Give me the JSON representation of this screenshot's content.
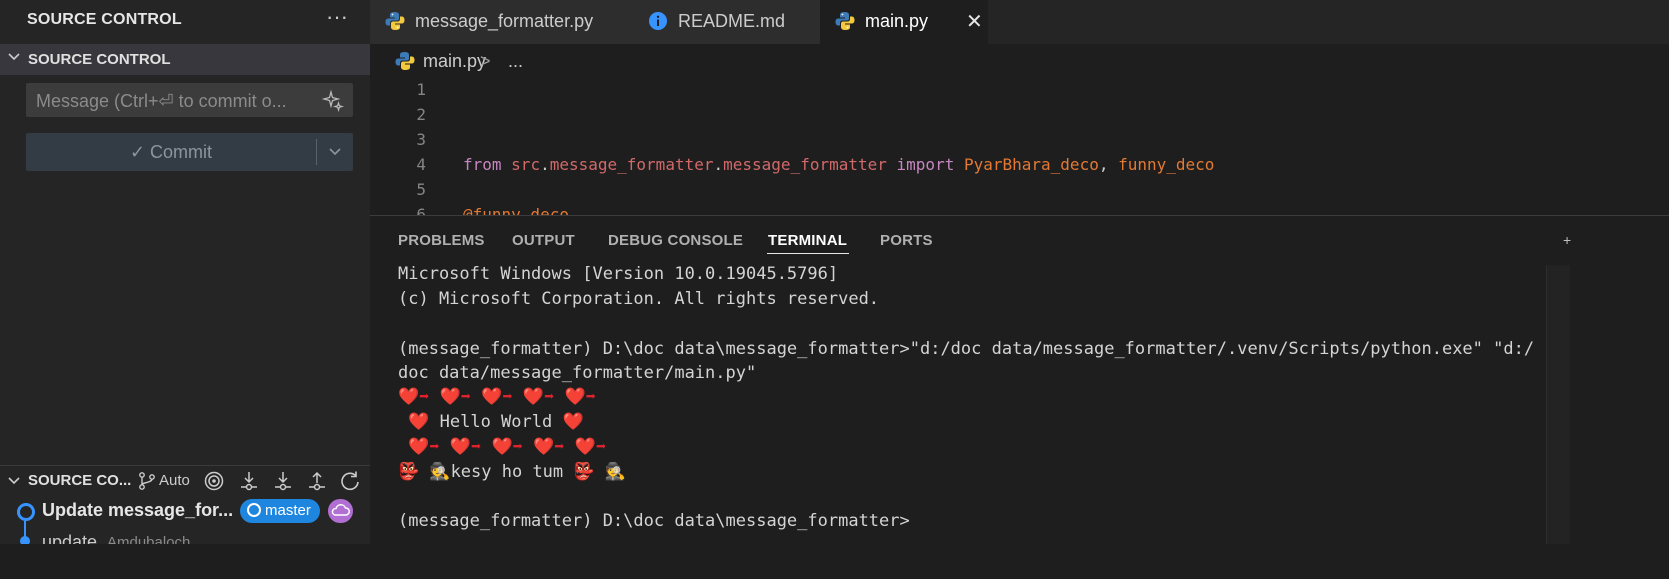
{
  "sidebar": {
    "title": "SOURCE CONTROL",
    "more_icon": "ellipsis-icon",
    "section_title": "SOURCE CONTROL",
    "message_placeholder": "Message (Ctrl+⏎ to commit o...",
    "commit_label": "✓ Commit",
    "graph_section_title": "SOURCE CO...",
    "graph_mode": "Auto",
    "graph_items": [
      {
        "title": "Update message_for...",
        "branch": "master"
      },
      {
        "title": "update",
        "author": "Amdubaloch"
      }
    ]
  },
  "tabs": [
    {
      "label": "message_formatter.py",
      "icon": "python-icon",
      "active": false
    },
    {
      "label": "README.md",
      "icon": "info-icon",
      "active": false
    },
    {
      "label": "main.py",
      "icon": "python-icon",
      "active": true
    }
  ],
  "breadcrumb": {
    "file": "main.py",
    "separator": ">",
    "ellipsis": "..."
  },
  "editor": {
    "line_numbers": [
      "1",
      "2",
      "3",
      "4",
      "5",
      "6"
    ],
    "line4": {
      "from": "from",
      "mod1": "src",
      "dot1": ".",
      "mod2": "message_formatter",
      "dot2": ".",
      "mod3": "message_formatter",
      "import": "import",
      "name1": "PyarBhara_deco",
      "comma": ",",
      "name2": "funny_deco"
    },
    "line6": "@funny_deco"
  },
  "panel": {
    "tabs": [
      "PROBLEMS",
      "OUTPUT",
      "DEBUG CONSOLE",
      "TERMINAL",
      "PORTS"
    ],
    "active_tab": "TERMINAL"
  },
  "terminal": {
    "lines": [
      "Microsoft Windows [Version 10.0.19045.5796]",
      "(c) Microsoft Corporation. All rights reserved.",
      "",
      "(message_formatter) D:\\doc data\\message_formatter>\"d:/doc data/message_formatter/.venv/Scripts/python.exe\" \"d:/",
      "doc data/message_formatter/main.py\"",
      "❤️➡ ❤️➡ ❤️➡ ❤️➡ ❤️➡",
      " ❤️ Hello World ❤️",
      " ❤️➡ ❤️➡ ❤️➡ ❤️➡ ❤️➡",
      "👺 🕵kesy ho tum 👺 🕵",
      "",
      "(message_formatter) D:\\doc data\\message_formatter>"
    ]
  },
  "colors": {
    "accent": "#3794ff",
    "branch_badge": "#1f86e0",
    "cloud_badge": "#b16fd3",
    "keyword": "#c586c0",
    "module": "#d16969",
    "identifier": "#e37933"
  }
}
